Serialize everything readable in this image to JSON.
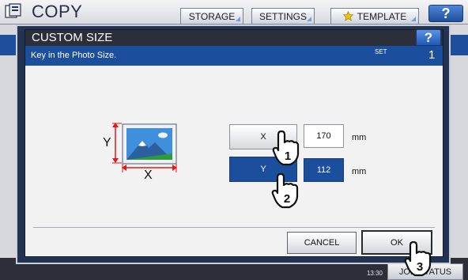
{
  "topbar": {
    "title": "COPY",
    "tabs": [
      {
        "label": "STORAGE",
        "icon": ""
      },
      {
        "label": "SETTINGS",
        "icon": ""
      },
      {
        "label": "TEMPLATE",
        "icon": "star-icon"
      }
    ],
    "help": "?"
  },
  "dialog": {
    "title": "CUSTOM SIZE",
    "help": "?",
    "message": "Key in the Photo Size.",
    "set_label": "SET",
    "set_count": "1",
    "x_axis_label": "X",
    "y_axis_label": "Y",
    "x_button": "X",
    "y_button": "Y",
    "x_value": "170",
    "y_value": "112",
    "unit": "mm",
    "cancel": "CANCEL",
    "ok": "OK"
  },
  "steps": [
    "1",
    "2",
    "3"
  ],
  "bottombar": {
    "time": "13:30",
    "job_status": "JOB STATUS"
  },
  "colors": {
    "accent_blue": "#1c4e9e",
    "header_dark": "#2b2f3a",
    "help_blue": "#2f6fd0"
  }
}
